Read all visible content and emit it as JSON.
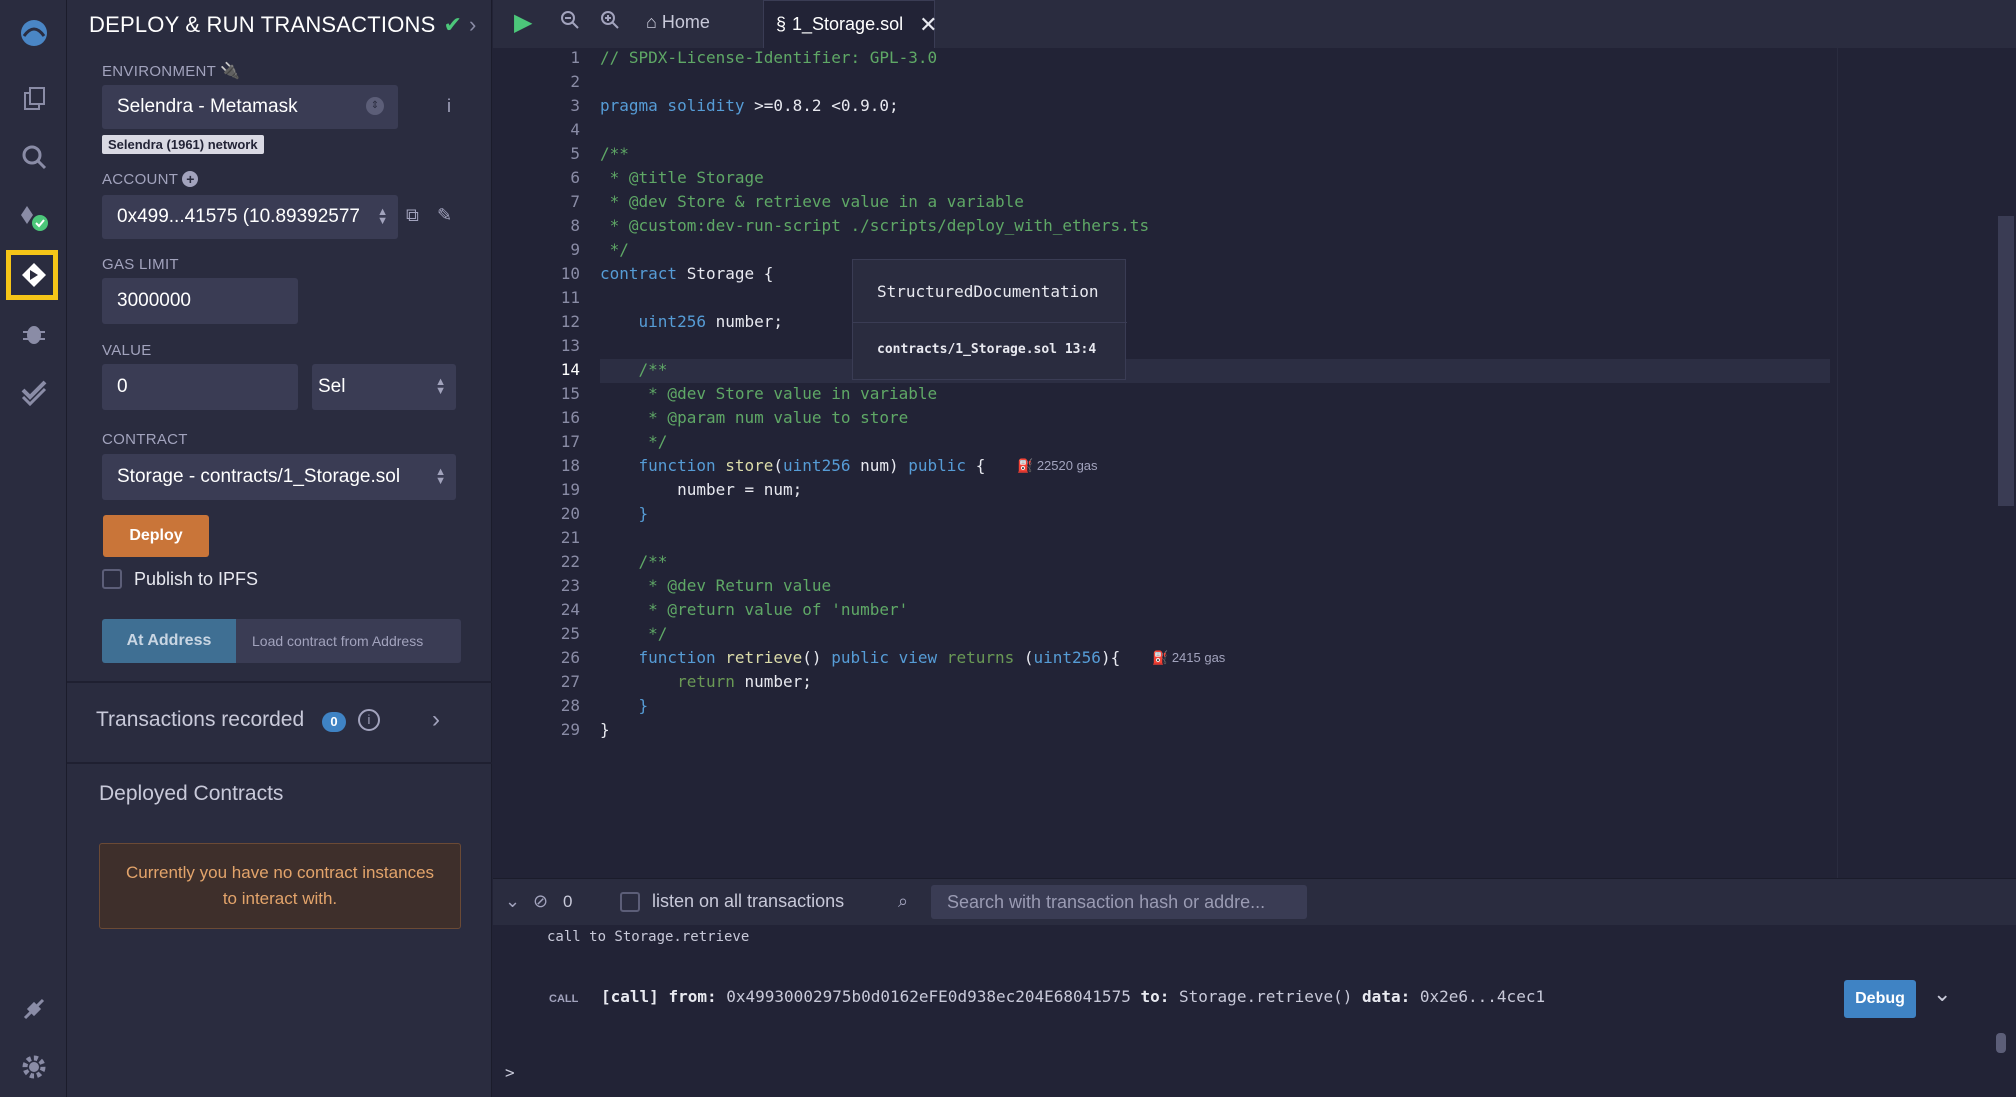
{
  "panel": {
    "title": "DEPLOY & RUN TRANSACTIONS",
    "environment_label": "ENVIRONMENT",
    "environment_value": "Selendra - Metamask",
    "network_badge": "Selendra (1961) network",
    "account_label": "ACCOUNT",
    "account_value": "0x499...41575 (10.89392577",
    "gas_limit_label": "GAS LIMIT",
    "gas_limit_value": "3000000",
    "value_label": "VALUE",
    "value_amount": "0",
    "value_unit": "Sel",
    "contract_label": "CONTRACT",
    "contract_value": "Storage - contracts/1_Storage.sol",
    "deploy_label": "Deploy",
    "publish_ipfs_label": "Publish to IPFS",
    "at_address_label": "At Address",
    "load_address_label": "Load contract from Address",
    "transactions_recorded_label": "Transactions recorded",
    "transactions_count": "0",
    "deployed_contracts_label": "Deployed Contracts",
    "no_contract_message": "Currently you have no contract instances to interact with."
  },
  "tabs": {
    "home_label": "Home",
    "file_label": "1_Storage.sol"
  },
  "editor": {
    "line_numbers": [
      "1",
      "2",
      "3",
      "4",
      "5",
      "6",
      "7",
      "8",
      "9",
      "10",
      "11",
      "12",
      "13",
      "14",
      "15",
      "16",
      "17",
      "18",
      "19",
      "20",
      "21",
      "22",
      "23",
      "24",
      "25",
      "26",
      "27",
      "28",
      "29"
    ],
    "current_line": "14",
    "line1": "// SPDX-License-Identifier: GPL-3.0",
    "line3_kw": "pragma solidity",
    "line3_rest": " >=0.8.2 <0.9.0;",
    "line5": "/**",
    "line6": " * @title Storage",
    "line7": " * @dev Store & retrieve value in a variable",
    "line8": " * @custom:dev-run-script ./scripts/deploy_with_ethers.ts",
    "line9": " */",
    "line10_kw": "contract",
    "line10_rest": " Storage {",
    "line12_ty": "    uint256",
    "line12_rest": " number;",
    "line14": "    /**",
    "line15": "     * @dev Store value in variable",
    "line16": "     * @param num value to store",
    "line17": "     */",
    "line18_kw": "    function",
    "line18_fn": " store",
    "line18_p1": "(",
    "line18_ty": "uint256",
    "line18_p2": " num) ",
    "line18_kw2": "public",
    "line18_p3": " {",
    "line19": "        number = num;",
    "line20": "    }",
    "line22": "    /**",
    "line23": "     * @dev Return value",
    "line24": "     * @return value of 'number'",
    "line25": "     */",
    "line26_kw": "    function",
    "line26_fn": " retrieve",
    "line26_p1": "() ",
    "line26_kw2": "public view",
    "line26_ret": " returns",
    "line26_p2": " (",
    "line26_ty": "uint256",
    "line26_p3": "){",
    "line27_kw": "        return",
    "line27_rest": " number;",
    "line28": "    }",
    "line29": "}",
    "gas_store": "22520 gas",
    "gas_retrieve": "2415 gas",
    "tooltip_title": "StructuredDocumentation",
    "tooltip_location": "contracts/1_Storage.sol 13:4"
  },
  "terminal": {
    "pending_count": "0",
    "listen_label": "listen on all transactions",
    "search_placeholder": "Search with transaction hash or addre...",
    "log_line": "call to Storage.retrieve",
    "call_tag": "CALL",
    "call_kind": "[call]",
    "from_label": "from:",
    "from_value": "0x49930002975b0d0162eFE0d938ec204E68041575",
    "to_label": "to:",
    "to_value": "Storage.retrieve()",
    "data_label": "data:",
    "data_value": "0x2e6...4cec1",
    "debug_label": "Debug",
    "prompt": ">"
  }
}
